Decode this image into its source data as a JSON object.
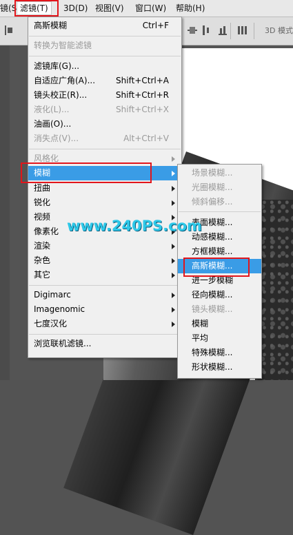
{
  "menubar": {
    "items": [
      {
        "label": "镜(S)"
      },
      {
        "label": "滤镜(T)",
        "active": true
      },
      {
        "label": "3D(D)"
      },
      {
        "label": "视图(V)"
      },
      {
        "label": "窗口(W)"
      },
      {
        "label": "帮助(H)"
      }
    ]
  },
  "options_bar": {
    "mode_label": "3D 模式"
  },
  "filter_menu": {
    "items": [
      {
        "label": "高斯模糊",
        "shortcut": "Ctrl+F"
      },
      {
        "label": "转换为智能滤镜",
        "disabled": true
      },
      {
        "label": "滤镜库(G)..."
      },
      {
        "label": "自适应广角(A)...",
        "shortcut": "Shift+Ctrl+A"
      },
      {
        "label": "镜头校正(R)...",
        "shortcut": "Shift+Ctrl+R"
      },
      {
        "label": "液化(L)...",
        "shortcut": "Shift+Ctrl+X",
        "disabled": true
      },
      {
        "label": "油画(O)..."
      },
      {
        "label": "消失点(V)...",
        "shortcut": "Alt+Ctrl+V",
        "disabled": true
      },
      {
        "label": "风格化",
        "disabled": true
      },
      {
        "label": "模糊",
        "highlighted": true
      },
      {
        "label": "扭曲"
      },
      {
        "label": "锐化"
      },
      {
        "label": "视频"
      },
      {
        "label": "像素化"
      },
      {
        "label": "渲染"
      },
      {
        "label": "杂色"
      },
      {
        "label": "其它"
      },
      {
        "label": "Digimarc"
      },
      {
        "label": "Imagenomic"
      },
      {
        "label": "七度汉化"
      },
      {
        "label": "浏览联机滤镜..."
      }
    ]
  },
  "blur_submenu": {
    "items": [
      {
        "label": "场景模糊...",
        "disabled": true
      },
      {
        "label": "光圈模糊...",
        "disabled": true
      },
      {
        "label": "倾斜偏移...",
        "disabled": true
      },
      {
        "label": "表面模糊..."
      },
      {
        "label": "动感模糊..."
      },
      {
        "label": "方框模糊..."
      },
      {
        "label": "高斯模糊...",
        "highlighted": true
      },
      {
        "label": "进一步模糊"
      },
      {
        "label": "径向模糊..."
      },
      {
        "label": "镜头模糊...",
        "disabled": true
      },
      {
        "label": "模糊"
      },
      {
        "label": "平均"
      },
      {
        "label": "特殊模糊..."
      },
      {
        "label": "形状模糊..."
      }
    ]
  },
  "watermark": {
    "text": "www.240PS.com"
  },
  "colors": {
    "highlight": "#3a9ce6",
    "callout": "#e2151b",
    "watermark": "#2ec8e8"
  }
}
